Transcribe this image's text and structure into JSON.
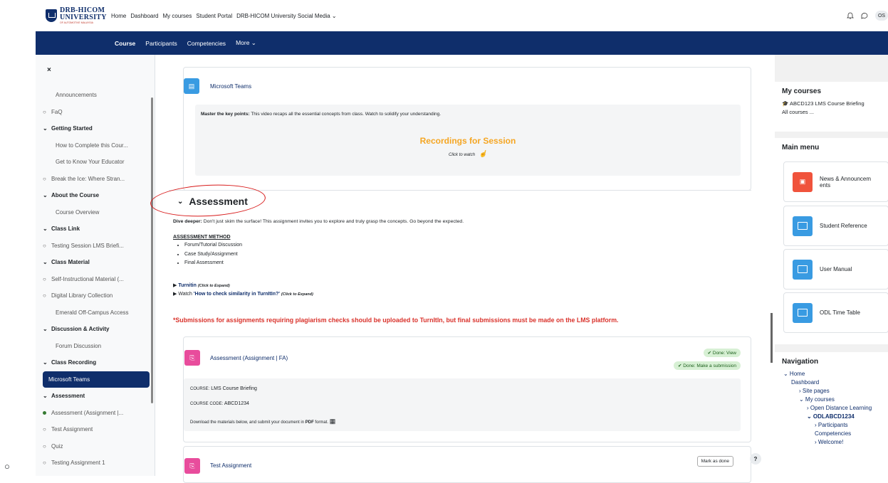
{
  "header": {
    "logo_line1": "DRB-HICOM",
    "logo_line2": "UNIVERSITY",
    "logo_tagline": "OF AUTOMOTIVE MALAYSIA",
    "nav": [
      "Home",
      "Dashboard",
      "My courses",
      "Student Portal",
      "DRB-HICOM University Social Media ⌄"
    ],
    "user_initials": "OS"
  },
  "secondary_nav": {
    "tabs": [
      "Course",
      "Participants",
      "Competencies",
      "More ⌄"
    ]
  },
  "drawer": {
    "close": "×",
    "items": [
      {
        "label": "Announcements",
        "type": "item",
        "mark": ""
      },
      {
        "label": "FaQ",
        "type": "item",
        "mark": "○"
      },
      {
        "label": "Getting Started",
        "type": "section",
        "mark": "⌄"
      },
      {
        "label": "How to Complete this Cour...",
        "type": "item",
        "mark": ""
      },
      {
        "label": "Get to Know Your Educator",
        "type": "item",
        "mark": ""
      },
      {
        "label": "Break the Ice: Where Stran...",
        "type": "item",
        "mark": "○"
      },
      {
        "label": "About the Course",
        "type": "section",
        "mark": "⌄"
      },
      {
        "label": "Course Overview",
        "type": "item",
        "mark": ""
      },
      {
        "label": "Class Link",
        "type": "section",
        "mark": "⌄"
      },
      {
        "label": "Testing Session LMS Briefi...",
        "type": "item",
        "mark": "○"
      },
      {
        "label": "Class Material",
        "type": "section",
        "mark": "⌄"
      },
      {
        "label": "Self-Instructional Material (...",
        "type": "item",
        "mark": "○"
      },
      {
        "label": "Digital Library Collection",
        "type": "item",
        "mark": "○"
      },
      {
        "label": "Emerald Off-Campus Access",
        "type": "item",
        "mark": ""
      },
      {
        "label": "Discussion & Activity",
        "type": "section",
        "mark": "⌄"
      },
      {
        "label": "Forum Discussion",
        "type": "item",
        "mark": ""
      },
      {
        "label": "Class Recording",
        "type": "section",
        "mark": "⌄"
      },
      {
        "label": "Microsoft Teams",
        "type": "active",
        "mark": ""
      },
      {
        "label": "Assessment",
        "type": "section",
        "mark": "⌄"
      },
      {
        "label": "Assessment (Assignment |...",
        "type": "done",
        "mark": "●"
      },
      {
        "label": "Test Assignment",
        "type": "item",
        "mark": "○"
      },
      {
        "label": "Quiz",
        "type": "item",
        "mark": "○"
      },
      {
        "label": "Testing Assignment 1",
        "type": "item",
        "mark": "○"
      }
    ]
  },
  "main": {
    "teams": {
      "title": "Microsoft Teams",
      "key_points_bold": "Master the key points:",
      "key_points_text": " This video recaps all the essential concepts from class. Watch to solidify your understanding.",
      "recordings_title": "Recordings for Session",
      "click_to_watch": "Click to watch"
    },
    "assessment": {
      "heading": "Assessment",
      "dive_bold": "Dive deeper:",
      "dive_text": " Don't just skim the surface! This assignment invites you to explore and truly grasp the concepts. Go beyond the expected.",
      "method_title": "ASSESSMENT METHOD",
      "methods": [
        "Forum/Tutorial Discussion",
        "Case Study/Assignment",
        "Final Assessment"
      ],
      "turnitin_link": "Turnitin",
      "turnitin_hint": "(Click to Expand)",
      "watch_prefix": "Watch ",
      "watch_link": "'How to check similarity in TurnItIn?'",
      "watch_hint": "(Click to Expand)",
      "warning": "*Submissions for assignments requiring plagiarism checks should be uploaded to TurnItIn, but final submissions must be made on the LMS platform."
    },
    "assignment_card": {
      "title": "Assessment (Assignment | FA)",
      "badge_view": "✔ Done: View",
      "badge_submit": "✔ Done: Make a submission",
      "course_label": "COURSE:",
      "course_value": " LMS Course Briefing",
      "code_label": "COURSE CODE:",
      "code_value": " ABCD1234",
      "download_text_pre": "Download the materials below, and submit your document in ",
      "download_bold": "PDF",
      "download_text_post": " format."
    },
    "test_card": {
      "title": "Test Assignment",
      "mark_done": "Mark as done",
      "help": "?"
    }
  },
  "right": {
    "my_courses_title": "My courses",
    "course_link": "ABCD123 LMS Course Briefing",
    "all_courses": "All courses ...",
    "main_menu_title": "Main menu",
    "menu_items": [
      "News & Announcem ents",
      "Student Reference",
      "User Manual",
      "ODL Time Table"
    ],
    "navigation_title": "Navigation",
    "nav_tree": [
      {
        "label": "⌄ Home",
        "level": 0
      },
      {
        "label": "Dashboard",
        "level": 1
      },
      {
        "label": "› Site pages",
        "level": 2
      },
      {
        "label": "⌄ My courses",
        "level": 2
      },
      {
        "label": "› Open Distance Learning",
        "level": 3
      },
      {
        "label": "⌄ ODLABCD1234",
        "level": 3
      },
      {
        "label": "› Participants",
        "level": 4
      },
      {
        "label": "Competencies",
        "level": 4
      },
      {
        "label": "› Welcome!",
        "level": 4
      }
    ]
  },
  "colors": {
    "brand": "#0f2e6b",
    "orange": "#f5a623",
    "warning_red": "#d9322b"
  }
}
